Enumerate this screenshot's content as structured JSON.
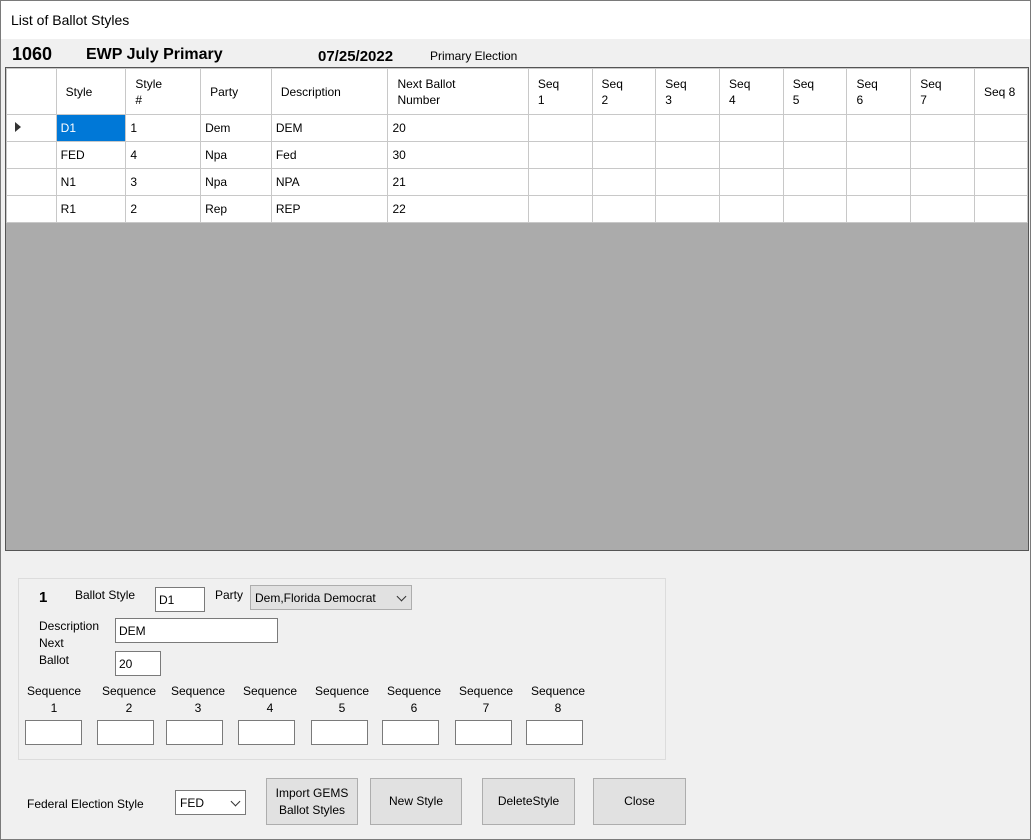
{
  "window": {
    "title": "List of Ballot Styles"
  },
  "header": {
    "election_id": "1060",
    "election_name": "EWP July Primary",
    "election_date": "07/25/2022",
    "election_type": "Primary Election"
  },
  "grid": {
    "columns": [
      "Style",
      "Style\n#",
      "Party",
      "Description",
      "Next Ballot\nNumber",
      "Seq\n1",
      "Seq\n2",
      "Seq\n3",
      "Seq\n4",
      "Seq\n5",
      "Seq\n6",
      "Seq\n7",
      "Seq 8"
    ],
    "rows": [
      {
        "style": "D1",
        "style_num": "1",
        "party": "Dem",
        "description": "DEM",
        "next_ballot": "20",
        "seqs": [
          "",
          "",
          "",
          "",
          "",
          "",
          "",
          ""
        ]
      },
      {
        "style": "FED",
        "style_num": "4",
        "party": "Npa",
        "description": "Fed",
        "next_ballot": "30",
        "seqs": [
          "",
          "",
          "",
          "",
          "",
          "",
          "",
          ""
        ]
      },
      {
        "style": "N1",
        "style_num": "3",
        "party": "Npa",
        "description": "NPA",
        "next_ballot": "21",
        "seqs": [
          "",
          "",
          "",
          "",
          "",
          "",
          "",
          ""
        ]
      },
      {
        "style": "R1",
        "style_num": "2",
        "party": "Rep",
        "description": "REP",
        "next_ballot": "22",
        "seqs": [
          "",
          "",
          "",
          "",
          "",
          "",
          "",
          ""
        ]
      }
    ],
    "selected_row": 0
  },
  "detail": {
    "record_number": "1",
    "ballot_style_label": "Ballot Style",
    "ballot_style_value": "D1",
    "party_label": "Party",
    "party_value": "Dem,Florida Democrat",
    "description_label": "Description",
    "description_value": "DEM",
    "next_label": "Next",
    "ballot_label": "Ballot",
    "next_ballot_value": "20",
    "sequence_label": "Sequence",
    "sequences": [
      {
        "num": "1",
        "value": ""
      },
      {
        "num": "2",
        "value": ""
      },
      {
        "num": "3",
        "value": ""
      },
      {
        "num": "4",
        "value": ""
      },
      {
        "num": "5",
        "value": ""
      },
      {
        "num": "6",
        "value": ""
      },
      {
        "num": "7",
        "value": ""
      },
      {
        "num": "8",
        "value": ""
      }
    ]
  },
  "footer": {
    "federal_label": "Federal Election Style",
    "federal_value": "FED",
    "import_line1": "Import GEMS",
    "import_line2": "Ballot Styles",
    "new_style": "New Style",
    "delete_style": "DeleteStyle",
    "close": "Close"
  },
  "colors": {
    "selection": "#0078d7",
    "grid_background": "#ababab"
  }
}
